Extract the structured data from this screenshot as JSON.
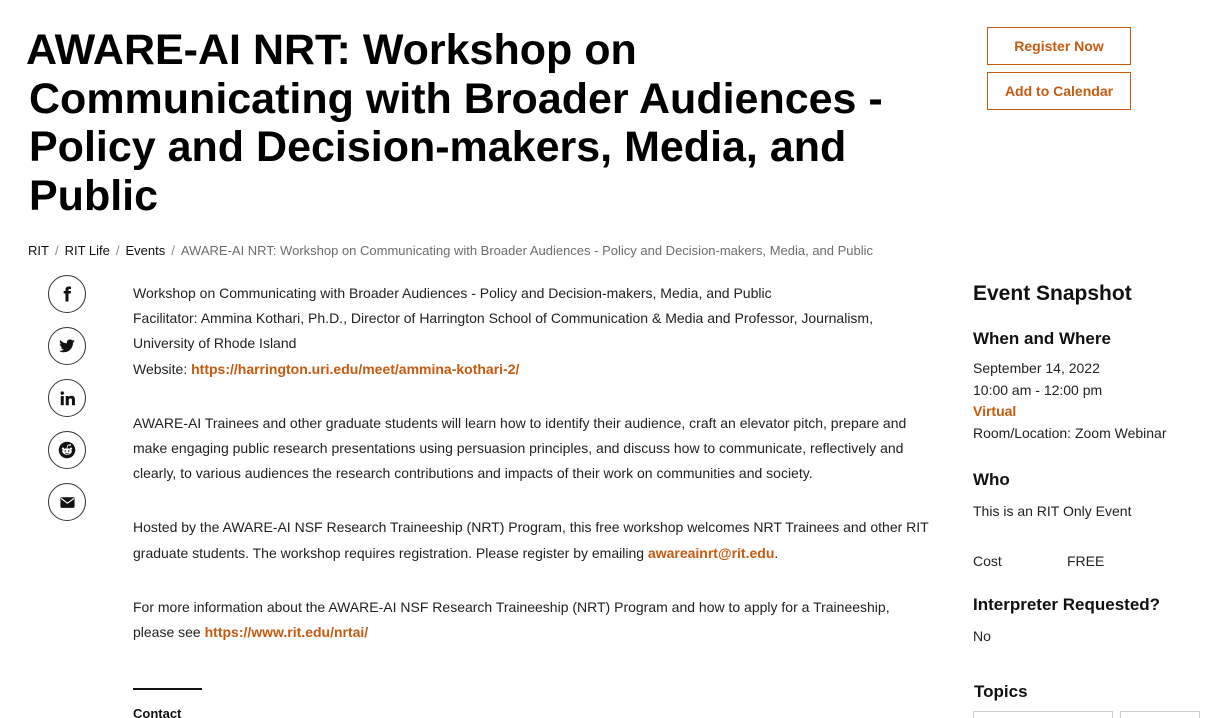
{
  "title_lines": [
    "AWARE-AI NRT: Workshop on",
    "Communicating with Broader Audiences -",
    "Policy and Decision-makers, Media, and",
    "Public"
  ],
  "actions": {
    "register": "Register Now",
    "calendar": "Add to Calendar"
  },
  "breadcrumb": {
    "items": [
      "RIT",
      "RIT Life",
      "Events"
    ],
    "separator": "/",
    "current": "AWARE-AI NRT: Workshop on Communicating with Broader Audiences - Policy and Decision-makers, Media, and Public"
  },
  "share": [
    {
      "icon": "facebook-icon"
    },
    {
      "icon": "twitter-icon"
    },
    {
      "icon": "linkedin-icon"
    },
    {
      "icon": "reddit-icon"
    },
    {
      "icon": "email-icon"
    }
  ],
  "body": {
    "intro_line": "Workshop on Communicating with Broader Audiences - Policy and Decision-makers, Media, and Public",
    "facilitator": "Facilitator: Ammina Kothari, Ph.D., Director of Harrington School of Communication & Media and Professor, Journalism, University of Rhode Island",
    "website_label": "Website:",
    "website_link": "https://harrington.uri.edu/meet/ammina-kothari-2/",
    "paragraph2": "AWARE-AI Trainees and other graduate students will learn how to identify their audience, craft an elevator pitch, prepare and make engaging public research presentations using persuasion principles, and discuss how to communicate, reflectively and clearly, to various audiences the research contributions and impacts of their work on communities and society.",
    "paragraph3": "Hosted by the AWARE-AI NSF Research Traineeship (NRT) Program, this free workshop welcomes NRT Trainees and other RIT graduate students. The workshop requires registration. Please register by emailing",
    "email_link": "awareainrt@rit.edu",
    "period": ".",
    "paragraph4": "For more information about the AWARE-AI NSF Research Traineeship (NRT) Program and how to apply for a Traineeship, please see",
    "nrtai_link": "https://www.rit.edu/nrtai/",
    "contact_label": "Contact"
  },
  "snapshot": {
    "title": "Event Snapshot",
    "when_where_heading": "When and Where",
    "date": "September 14, 2022",
    "time": "10:00 am - 12:00 pm",
    "mode": "Virtual",
    "location": "Room/Location: Zoom Webinar",
    "who_heading": "Who",
    "who_text": "This is an RIT Only Event",
    "cost_label": "Cost",
    "cost_value": "FREE",
    "interpreter_heading": "Interpreter Requested?",
    "interpreter_value": "No",
    "topics_heading": "Topics"
  },
  "colors": {
    "accent": "#c65a0f",
    "text": "#222222",
    "heading": "#000000",
    "muted": "#6d6d6d"
  }
}
